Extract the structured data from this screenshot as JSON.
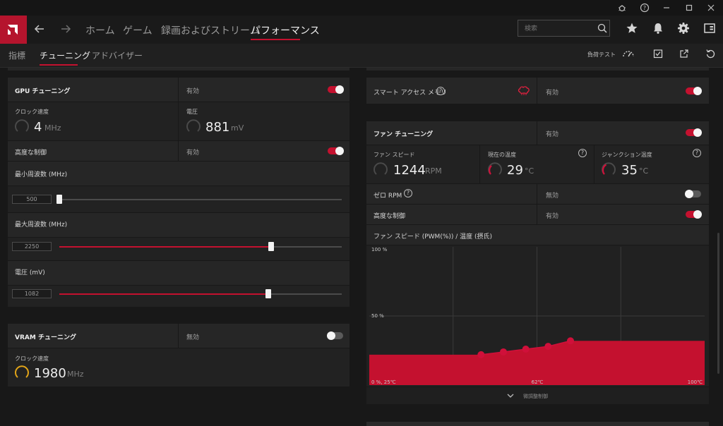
{
  "window": {
    "controls": [
      "bug-icon",
      "help-icon",
      "minimize-icon",
      "maximize-icon",
      "close-icon"
    ]
  },
  "nav": {
    "home": "ホーム",
    "games": "ゲーム",
    "record": "録画およびストリーム",
    "performance": "パフォーマンス",
    "search_placeholder": "検索"
  },
  "subnav": {
    "metrics": "指標",
    "tuning": "チューニング",
    "advisor": "アドバイザー",
    "stress_test": "負荷テスト"
  },
  "gpu_tuning": {
    "title": "GPU チューニング",
    "status": "有効",
    "clock_label": "クロック速度",
    "clock_value": "4",
    "clock_unit": "MHz",
    "voltage_label": "電圧",
    "voltage_value": "881",
    "voltage_unit": "mV",
    "advanced_label": "高度な制御",
    "advanced_status": "有効",
    "min_freq_label": "最小周波数 (MHz)",
    "min_freq_value": "500",
    "min_freq_fraction": 0.0,
    "max_freq_label": "最大周波数 (MHz)",
    "max_freq_value": "2250",
    "max_freq_fraction": 0.75,
    "voltage_ctrl_label": "電圧 (mV)",
    "voltage_ctrl_value": "1082",
    "voltage_ctrl_fraction": 0.74
  },
  "vram_tuning": {
    "title": "VRAM チューニング",
    "status": "無効",
    "clock_label": "クロック速度",
    "clock_value": "1980",
    "clock_unit": "MHz"
  },
  "sam": {
    "title": "スマート アクセス メモリ",
    "status": "有効"
  },
  "fan_tuning": {
    "title": "ファン チューニング",
    "status": "有効",
    "speed_label": "ファン スピード",
    "speed_value": "1244",
    "speed_unit": "RPM",
    "temp_label": "現在の温度",
    "temp_value": "29",
    "temp_unit": "°C",
    "junction_label": "ジャンクション温度",
    "junction_value": "35",
    "junction_unit": "°C",
    "zero_rpm_label": "ゼロ RPM",
    "zero_rpm_status": "無効",
    "advanced_label": "高度な制御",
    "advanced_status": "有効",
    "curve_title": "ファン スピード (PWM(%)) / 温度 (摂氏)",
    "fine_tune": "微調整制御"
  },
  "chart_data": {
    "type": "area",
    "title": "ファン スピード (PWM(%)) / 温度 (摂氏)",
    "xlabel": "温度 (摂氏)",
    "ylabel": "ファン スピード (PWM(%))",
    "xlim": [
      25,
      100
    ],
    "ylim": [
      0,
      100
    ],
    "tick_labels": {
      "y_top": "100 %",
      "y_mid": "50 %",
      "x_left": "0 %, 25℃",
      "x_mid": "62℃",
      "x_right": "100℃"
    },
    "points": [
      [
        50,
        22
      ],
      [
        55,
        24
      ],
      [
        60,
        26
      ],
      [
        65,
        28
      ],
      [
        70,
        32
      ]
    ],
    "area_after_last": [
      [
        100,
        32
      ]
    ],
    "colors": {
      "area": "#c4112f",
      "points": "#d0103a",
      "grid": "#3a3a3a"
    }
  },
  "colors": {
    "accent": "#c4112f",
    "panel": "#262626",
    "background": "#181818"
  }
}
